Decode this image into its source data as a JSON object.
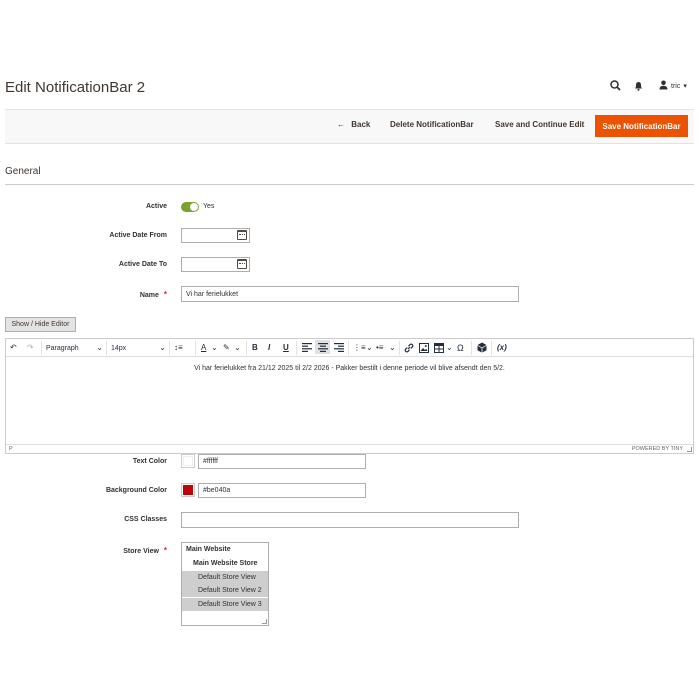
{
  "page": {
    "title": "Edit NotificationBar 2"
  },
  "header": {
    "search_icon": "search-icon",
    "bell_icon": "bell-icon",
    "user_icon": "user-icon",
    "user_name": "tric",
    "user_caret": "▾"
  },
  "actions": {
    "back_arrow": "←",
    "back": "Back",
    "delete": "Delete NotificationBar",
    "save_continue": "Save and Continue Edit",
    "save": "Save NotificationBar"
  },
  "section": {
    "title": "General"
  },
  "form": {
    "active": {
      "label": "Active",
      "value": "Yes"
    },
    "date_from": {
      "label": "Active Date From",
      "value": ""
    },
    "date_to": {
      "label": "Active Date To",
      "value": ""
    },
    "name": {
      "label": "Name",
      "required": "*",
      "value": "Vi har ferielukket"
    },
    "show_hide_editor": "Show / Hide Editor",
    "text_color": {
      "label": "Text Color",
      "value": "#ffffff",
      "swatch": "#ffffff"
    },
    "bg_color": {
      "label": "Background Color",
      "value": "#be040a",
      "swatch": "#be040a"
    },
    "css_classes": {
      "label": "CSS Classes",
      "value": ""
    },
    "store_view": {
      "label": "Store View",
      "required": "*",
      "options": [
        {
          "label": "Main Website",
          "selected": false
        },
        {
          "label": "Main Website Store",
          "selected": false
        },
        {
          "label": "Default Store View",
          "selected": true
        },
        {
          "label": "Default Store View 2",
          "selected": true
        },
        {
          "label": "Default Store View 3",
          "selected": true
        }
      ]
    }
  },
  "editor": {
    "format": "Paragraph",
    "font_size": "14px",
    "content": "Vi har ferielukket fra 21/12 2025 til 2/2 2026 - Pakker bestilt i denne periode vil blive afsendt den 5/2.",
    "path": "P",
    "powered_by": "POWERED BY TINY",
    "toolbar_glyphs": {
      "undo": "↶",
      "redo": "↷",
      "caret": "⌄",
      "line_height": "↕≡",
      "text_color": "A",
      "highlight": "✎",
      "bold": "B",
      "italic": "I",
      "underline": "U",
      "numlist": "⋮≡",
      "bullist": "•≡",
      "link": "🔗",
      "image": "▣",
      "table": "⊞",
      "omega": "Ω",
      "widget": "⬢",
      "variable": "(x)"
    }
  }
}
